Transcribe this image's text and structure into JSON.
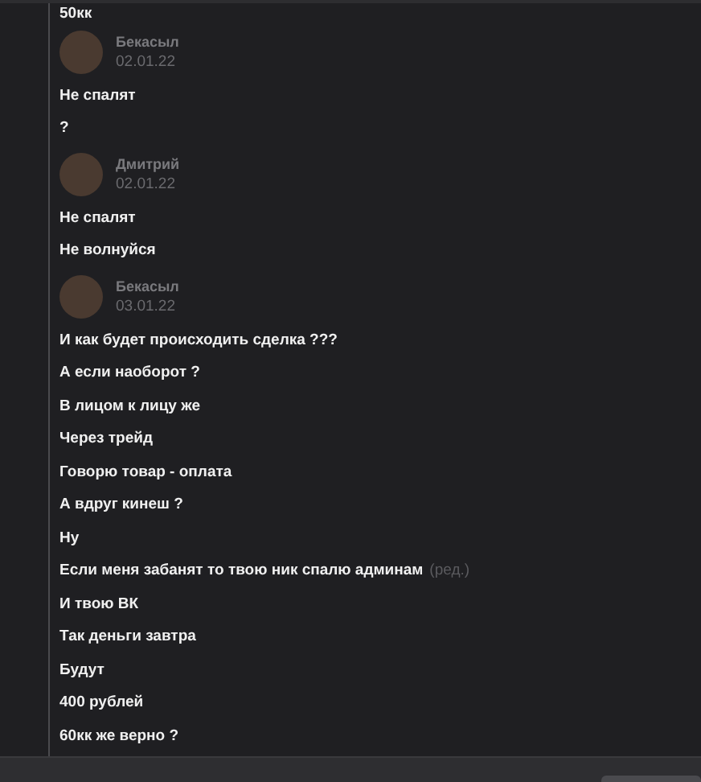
{
  "messages": [
    {
      "lines": [
        {
          "text": "50кк"
        }
      ]
    },
    {
      "author": "Бекасыл",
      "date": "02.01.22",
      "lines": [
        {
          "text": "Не спалят"
        },
        {
          "text": "?"
        }
      ]
    },
    {
      "author": "Дмитрий",
      "date": "02.01.22",
      "lines": [
        {
          "text": "Не спалят"
        },
        {
          "text": "Не волнуйся"
        }
      ]
    },
    {
      "author": "Бекасыл",
      "date": "03.01.22",
      "lines": [
        {
          "text": "И как будет происходить сделка ???"
        },
        {
          "text": "А если наоборот ?"
        },
        {
          "text": "В лицом к лицу же"
        },
        {
          "text": "Через трейд"
        },
        {
          "text": "Говорю товар - оплата"
        },
        {
          "text": "А вдруг кинеш ?"
        },
        {
          "text": "Ну"
        },
        {
          "text": "Если меня забанят то твою ник спалю админам",
          "edited_label": "(ред.)"
        },
        {
          "text": "И твою ВК"
        },
        {
          "text": "Так деньги завтра"
        },
        {
          "text": "Будут"
        },
        {
          "text": "400 рублей"
        },
        {
          "text": "60кк же верно ?"
        }
      ]
    }
  ]
}
